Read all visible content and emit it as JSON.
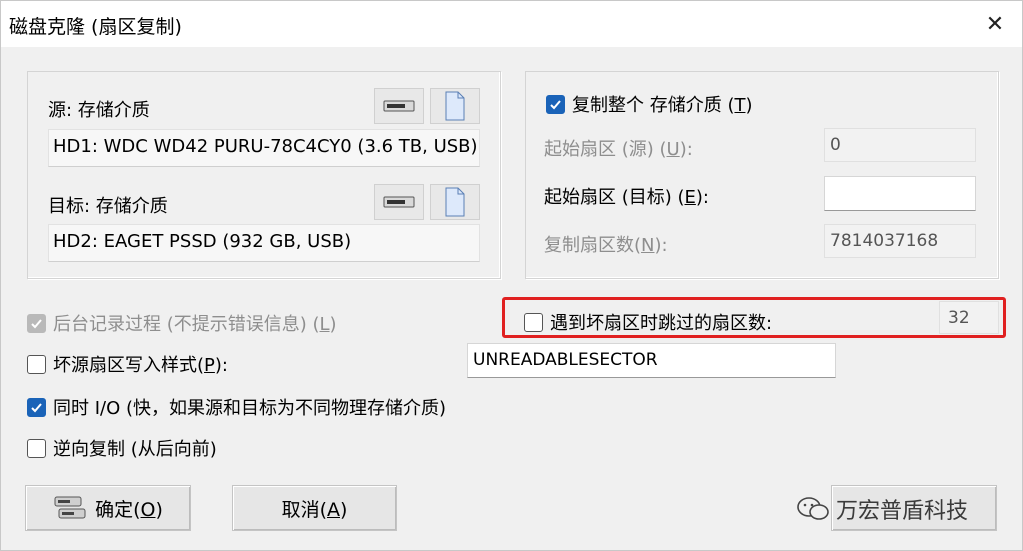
{
  "window": {
    "title": "磁盘克隆 (扇区复制)",
    "close_glyph": "✕"
  },
  "source": {
    "label_prefix": "源: ",
    "label_text": "存储介质",
    "value": "HD1: WDC WD42 PURU-78C4CY0 (3.6 TB, USB)"
  },
  "target": {
    "label_prefix": "目标: ",
    "label_text": "存储介质",
    "value": "HD2: EAGET PSSD (932 GB, USB)"
  },
  "copy_options": {
    "copy_whole_label": "复制整个 存储介质 (",
    "copy_whole_key": "T",
    "copy_whole_checked": true,
    "start_src_label": "起始扇区 (源) (",
    "start_src_key": "U",
    "start_src_value": "0",
    "start_dst_label": "起始扇区 (目标) (",
    "start_dst_key": "E",
    "start_dst_value": "",
    "count_label": "复制扇区数(",
    "count_key": "N",
    "count_value": "7814037168",
    "close_paren": ")",
    "colon": ":"
  },
  "options": {
    "log_label": "后台记录过程 (不提示错误信息) (",
    "log_key": "L",
    "skip_label": "遇到坏扇区时跳过的扇区数:",
    "skip_value": "32",
    "bad_pattern_label": "坏源扇区写入样式(",
    "bad_pattern_key": "P",
    "bad_pattern_value": "UNREADABLESECTOR",
    "simul_io_label": "同时 I/O (快，如果源和目标为不同物理存储介质)",
    "reverse_label": "逆向复制 (从后向前)"
  },
  "buttons": {
    "ok_label": "确定(",
    "ok_key": "O",
    "cancel_label": "取消(",
    "cancel_key": "A",
    "close_paren": ")"
  },
  "watermark": {
    "text": "万宏普盾科技"
  },
  "colors": {
    "accent": "#1a63b8",
    "highlight": "#e02020"
  }
}
